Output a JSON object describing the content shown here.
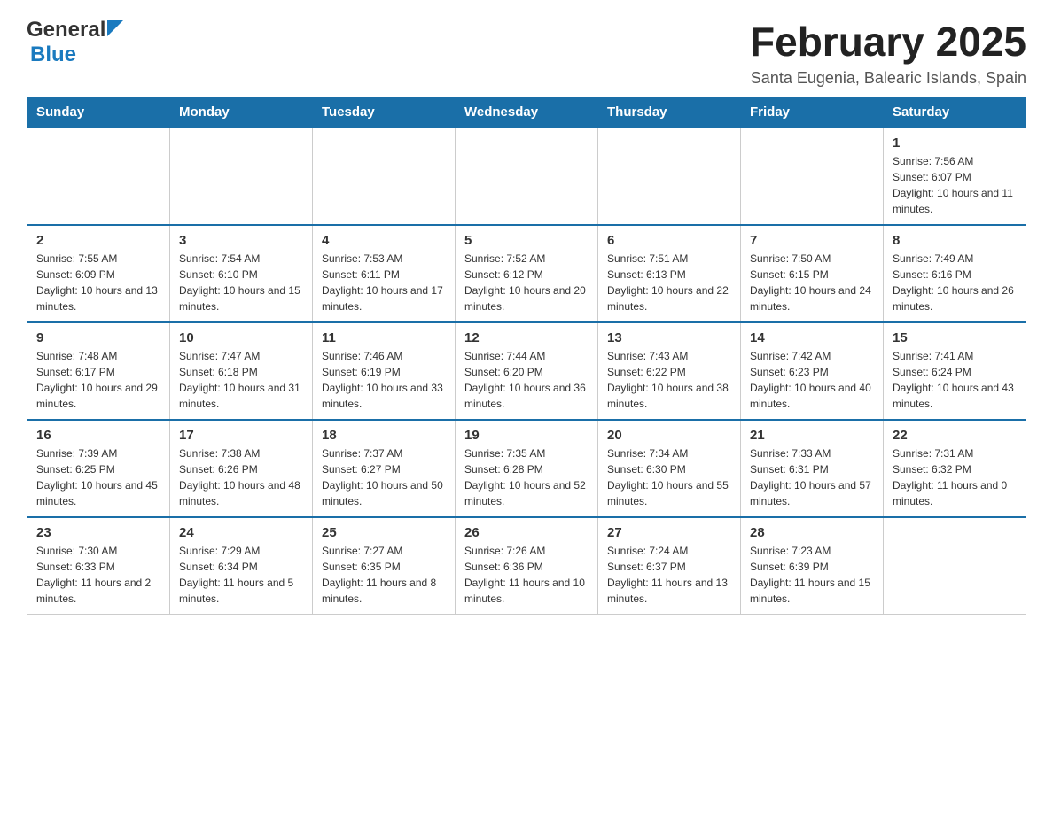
{
  "header": {
    "logo_general": "General",
    "logo_blue": "Blue",
    "month_title": "February 2025",
    "location": "Santa Eugenia, Balearic Islands, Spain"
  },
  "days_of_week": [
    "Sunday",
    "Monday",
    "Tuesday",
    "Wednesday",
    "Thursday",
    "Friday",
    "Saturday"
  ],
  "weeks": [
    [
      {
        "day": "",
        "info": ""
      },
      {
        "day": "",
        "info": ""
      },
      {
        "day": "",
        "info": ""
      },
      {
        "day": "",
        "info": ""
      },
      {
        "day": "",
        "info": ""
      },
      {
        "day": "",
        "info": ""
      },
      {
        "day": "1",
        "info": "Sunrise: 7:56 AM\nSunset: 6:07 PM\nDaylight: 10 hours and 11 minutes."
      }
    ],
    [
      {
        "day": "2",
        "info": "Sunrise: 7:55 AM\nSunset: 6:09 PM\nDaylight: 10 hours and 13 minutes."
      },
      {
        "day": "3",
        "info": "Sunrise: 7:54 AM\nSunset: 6:10 PM\nDaylight: 10 hours and 15 minutes."
      },
      {
        "day": "4",
        "info": "Sunrise: 7:53 AM\nSunset: 6:11 PM\nDaylight: 10 hours and 17 minutes."
      },
      {
        "day": "5",
        "info": "Sunrise: 7:52 AM\nSunset: 6:12 PM\nDaylight: 10 hours and 20 minutes."
      },
      {
        "day": "6",
        "info": "Sunrise: 7:51 AM\nSunset: 6:13 PM\nDaylight: 10 hours and 22 minutes."
      },
      {
        "day": "7",
        "info": "Sunrise: 7:50 AM\nSunset: 6:15 PM\nDaylight: 10 hours and 24 minutes."
      },
      {
        "day": "8",
        "info": "Sunrise: 7:49 AM\nSunset: 6:16 PM\nDaylight: 10 hours and 26 minutes."
      }
    ],
    [
      {
        "day": "9",
        "info": "Sunrise: 7:48 AM\nSunset: 6:17 PM\nDaylight: 10 hours and 29 minutes."
      },
      {
        "day": "10",
        "info": "Sunrise: 7:47 AM\nSunset: 6:18 PM\nDaylight: 10 hours and 31 minutes."
      },
      {
        "day": "11",
        "info": "Sunrise: 7:46 AM\nSunset: 6:19 PM\nDaylight: 10 hours and 33 minutes."
      },
      {
        "day": "12",
        "info": "Sunrise: 7:44 AM\nSunset: 6:20 PM\nDaylight: 10 hours and 36 minutes."
      },
      {
        "day": "13",
        "info": "Sunrise: 7:43 AM\nSunset: 6:22 PM\nDaylight: 10 hours and 38 minutes."
      },
      {
        "day": "14",
        "info": "Sunrise: 7:42 AM\nSunset: 6:23 PM\nDaylight: 10 hours and 40 minutes."
      },
      {
        "day": "15",
        "info": "Sunrise: 7:41 AM\nSunset: 6:24 PM\nDaylight: 10 hours and 43 minutes."
      }
    ],
    [
      {
        "day": "16",
        "info": "Sunrise: 7:39 AM\nSunset: 6:25 PM\nDaylight: 10 hours and 45 minutes."
      },
      {
        "day": "17",
        "info": "Sunrise: 7:38 AM\nSunset: 6:26 PM\nDaylight: 10 hours and 48 minutes."
      },
      {
        "day": "18",
        "info": "Sunrise: 7:37 AM\nSunset: 6:27 PM\nDaylight: 10 hours and 50 minutes."
      },
      {
        "day": "19",
        "info": "Sunrise: 7:35 AM\nSunset: 6:28 PM\nDaylight: 10 hours and 52 minutes."
      },
      {
        "day": "20",
        "info": "Sunrise: 7:34 AM\nSunset: 6:30 PM\nDaylight: 10 hours and 55 minutes."
      },
      {
        "day": "21",
        "info": "Sunrise: 7:33 AM\nSunset: 6:31 PM\nDaylight: 10 hours and 57 minutes."
      },
      {
        "day": "22",
        "info": "Sunrise: 7:31 AM\nSunset: 6:32 PM\nDaylight: 11 hours and 0 minutes."
      }
    ],
    [
      {
        "day": "23",
        "info": "Sunrise: 7:30 AM\nSunset: 6:33 PM\nDaylight: 11 hours and 2 minutes."
      },
      {
        "day": "24",
        "info": "Sunrise: 7:29 AM\nSunset: 6:34 PM\nDaylight: 11 hours and 5 minutes."
      },
      {
        "day": "25",
        "info": "Sunrise: 7:27 AM\nSunset: 6:35 PM\nDaylight: 11 hours and 8 minutes."
      },
      {
        "day": "26",
        "info": "Sunrise: 7:26 AM\nSunset: 6:36 PM\nDaylight: 11 hours and 10 minutes."
      },
      {
        "day": "27",
        "info": "Sunrise: 7:24 AM\nSunset: 6:37 PM\nDaylight: 11 hours and 13 minutes."
      },
      {
        "day": "28",
        "info": "Sunrise: 7:23 AM\nSunset: 6:39 PM\nDaylight: 11 hours and 15 minutes."
      },
      {
        "day": "",
        "info": ""
      }
    ]
  ]
}
